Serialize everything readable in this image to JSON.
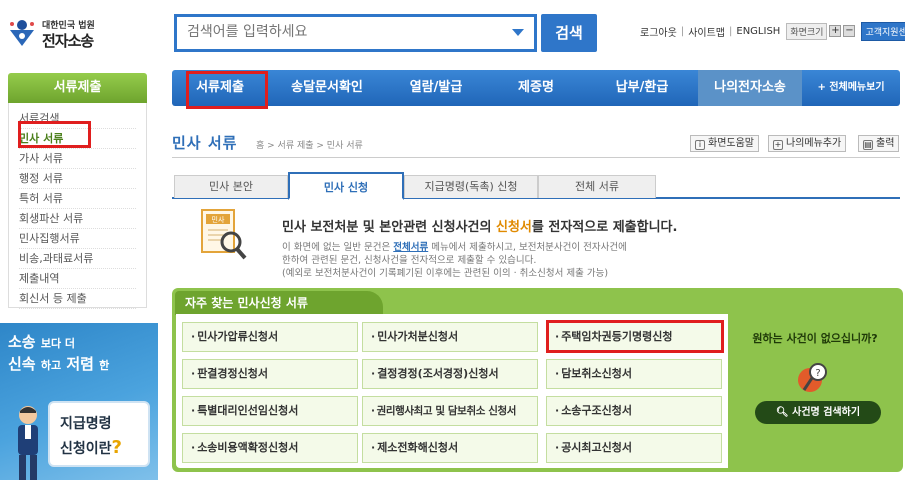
{
  "logo": {
    "line1": "대한민국 법원",
    "line2": "전자소송"
  },
  "search": {
    "placeholder": "검색어를 입력하세요",
    "button": "검색"
  },
  "util": {
    "logout": "로그아웃",
    "sitemap": "사이트맵",
    "english": "ENGLISH",
    "zoom": "화면크기",
    "plus": "+",
    "minus": "−",
    "support": "고객지원센터"
  },
  "sidebar": {
    "header": "서류제출",
    "items": [
      {
        "label": "서류검색"
      },
      {
        "label": "민사 서류"
      },
      {
        "label": "가사 서류"
      },
      {
        "label": "행정 서류"
      },
      {
        "label": "특허 서류"
      },
      {
        "label": "회생파산 서류"
      },
      {
        "label": "민사집행서류"
      },
      {
        "label": "비송,과태료서류"
      },
      {
        "label": "제출내역"
      },
      {
        "label": "회신서 등 제출"
      }
    ]
  },
  "promo": {
    "line1a": "소송",
    "line1b": "보다 더",
    "line2a": "신속",
    "line2b": "하고",
    "line2c": "저렴",
    "line2d": "한",
    "board1": "지급명령",
    "board2": "신청이란",
    "board2q": "?"
  },
  "nav": {
    "tabs": [
      {
        "label": "서류제출"
      },
      {
        "label": "송달문서확인"
      },
      {
        "label": "열람/발급"
      },
      {
        "label": "제증명"
      },
      {
        "label": "납부/환급"
      },
      {
        "label": "나의전자소송"
      },
      {
        "label": "+ 전체메뉴보기"
      }
    ]
  },
  "page": {
    "title": "민사 서류",
    "breadcrumb": "홈 > 서류 제출 > 민사 서류",
    "tools": {
      "help": "화면도움말",
      "my_menu": "나의메뉴추가",
      "print": "출력"
    }
  },
  "subtabs": [
    {
      "label": "민사 본안"
    },
    {
      "label": "민사 신청"
    },
    {
      "label": "지급명령(독촉) 신청"
    },
    {
      "label": "전체 서류"
    }
  ],
  "intro": {
    "doc_icon_label": "민사",
    "main_pre": "민사 보전처분 및 본안관련 신청사건의 ",
    "main_hi": "신청서",
    "main_post": "를 전자적으로 제출합니다.",
    "sub1_pre": "이 화면에 없는 일반 문건은 ",
    "sub1_link": "전체서류",
    "sub1_post": " 메뉴에서 제출하시고, 보전처분사건이 전자사건에",
    "sub2": "한하여 관련된 문건, 신청사건을 전자적으로 제출할 수 있습니다.",
    "sub3": "(예외로 보전처분사건이 기록폐기된 이후에는 관련된 이의 · 취소신청서 제출 가능)"
  },
  "frequent": {
    "title": "자주 찾는 민사신청 서류",
    "items": [
      {
        "label": "민사가압류신청서"
      },
      {
        "label": "민사가처분신청서"
      },
      {
        "label": "주택임차권등기명령신청"
      },
      {
        "label": "판결경정신청서"
      },
      {
        "label": "결정경정(조서경정)신청서"
      },
      {
        "label": "담보취소신청서"
      },
      {
        "label": "특별대리인선임신청서"
      },
      {
        "label": "권리행사최고 및 담보취소 신청서"
      },
      {
        "label": "소송구조신청서"
      },
      {
        "label": "소송비용액확정신청서"
      },
      {
        "label": "제소전화해신청서"
      },
      {
        "label": "공시최고신청서"
      }
    ],
    "help_question": "원하는 사건이 없으십니까?",
    "help_button": "사건명 검색하기"
  }
}
